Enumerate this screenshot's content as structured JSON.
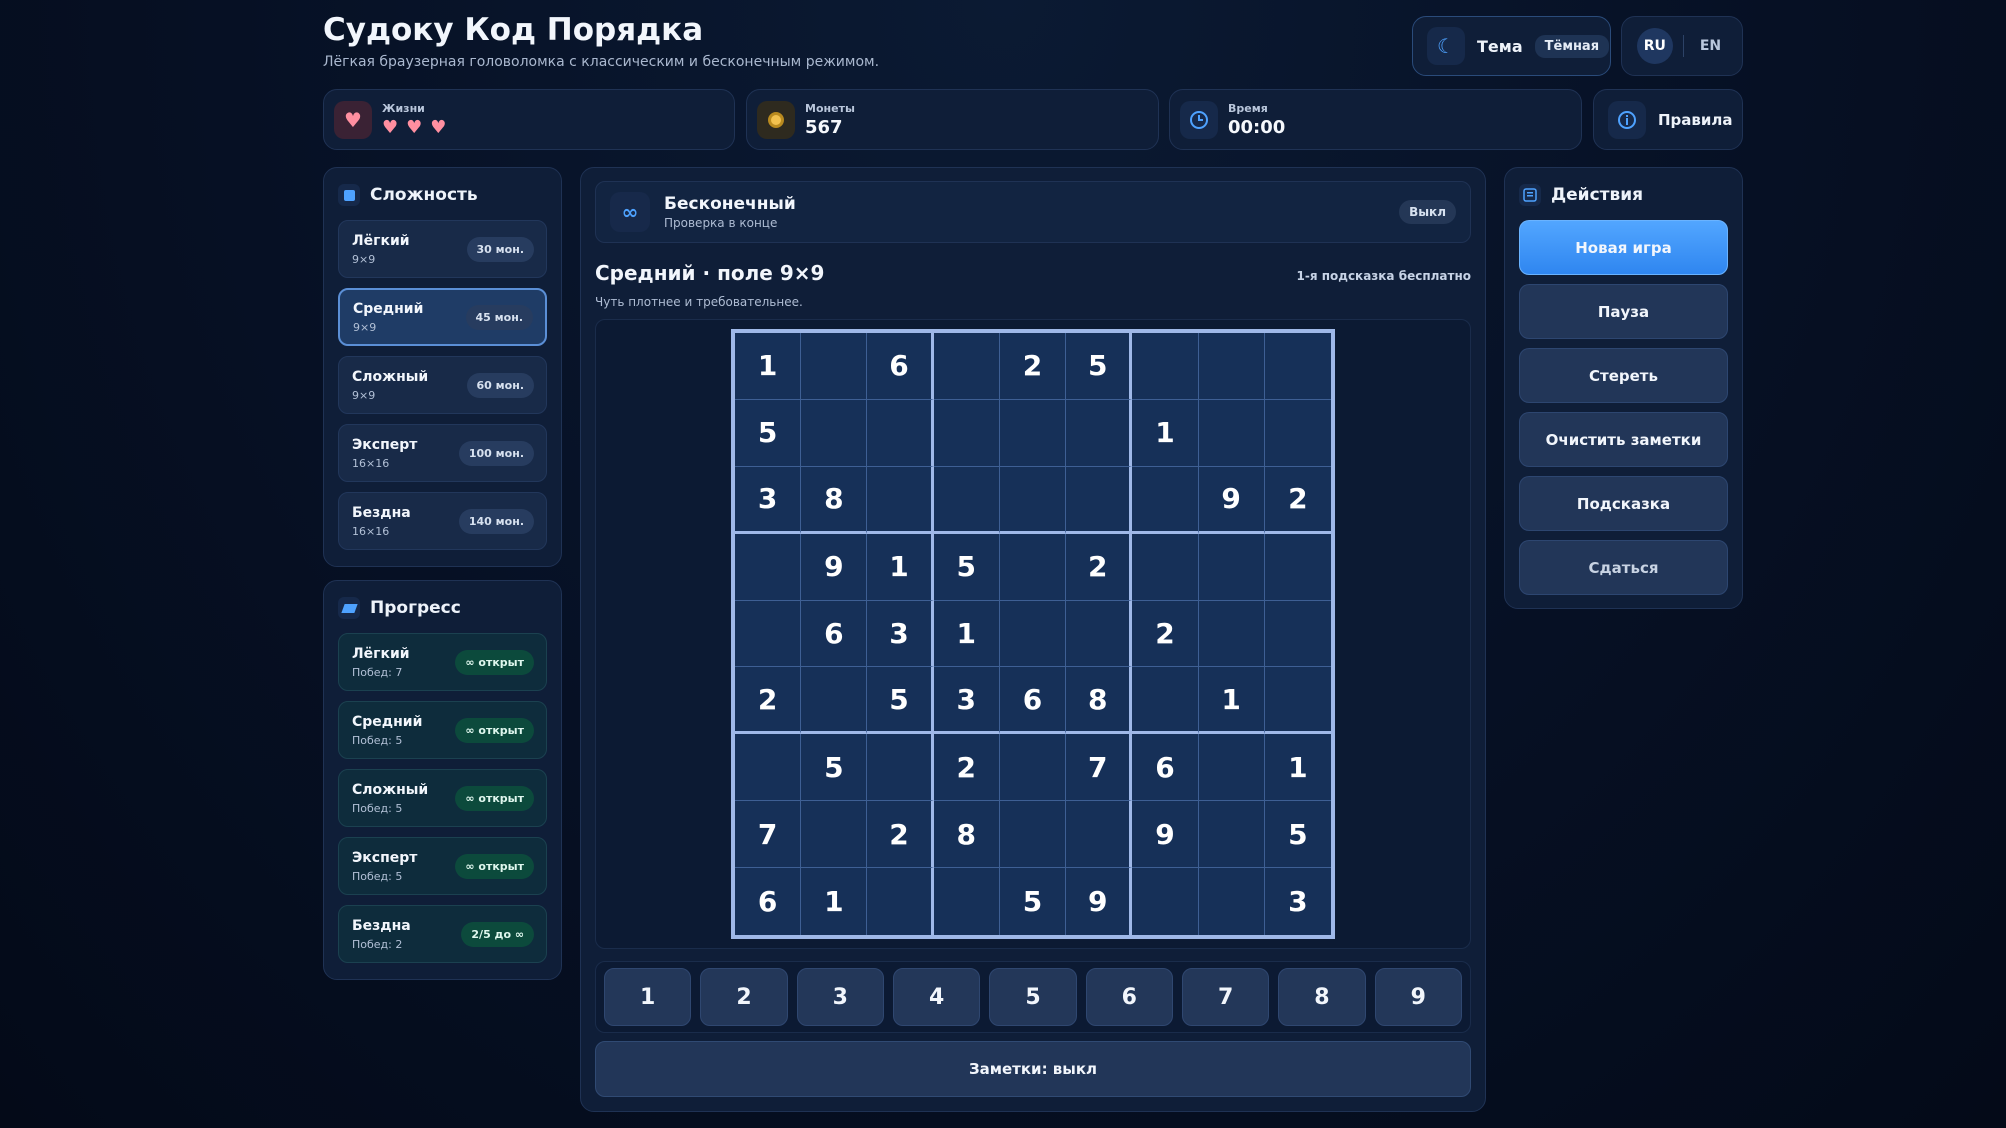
{
  "header": {
    "title": "Судоку Код Порядка",
    "subtitle": "Лёгкая браузерная головоломка с классическим и бесконечным режимом.",
    "theme_label": "Тема",
    "theme_value": "Тёмная",
    "lang_ru": "RU",
    "lang_en": "EN"
  },
  "stats": {
    "lives_label": "Жизни",
    "lives_count": 3,
    "coins_label": "Монеты",
    "coins_value": "567",
    "time_label": "Время",
    "time_value": "00:00",
    "rules_label": "Правила"
  },
  "difficulty": {
    "title": "Сложность",
    "items": [
      {
        "name": "Лёгкий",
        "size": "9×9",
        "cost": "30 мон."
      },
      {
        "name": "Средний",
        "size": "9×9",
        "cost": "45 мон."
      },
      {
        "name": "Сложный",
        "size": "9×9",
        "cost": "60 мон."
      },
      {
        "name": "Эксперт",
        "size": "16×16",
        "cost": "100 мон."
      },
      {
        "name": "Бездна",
        "size": "16×16",
        "cost": "140 мон."
      }
    ]
  },
  "progress": {
    "title": "Прогресс",
    "items": [
      {
        "name": "Лёгкий",
        "wins": "Побед: 7",
        "status": "∞ открыт"
      },
      {
        "name": "Средний",
        "wins": "Побед: 5",
        "status": "∞ открыт"
      },
      {
        "name": "Сложный",
        "wins": "Побед: 5",
        "status": "∞ открыт"
      },
      {
        "name": "Эксперт",
        "wins": "Побед: 5",
        "status": "∞ открыт"
      },
      {
        "name": "Бездна",
        "wins": "Побед: 2",
        "status": "2/5 до ∞"
      }
    ]
  },
  "mode": {
    "icon": "∞",
    "title": "Бесконечный",
    "subtitle": "Проверка в конце",
    "toggle": "Выкл"
  },
  "board": {
    "title": "Средний · поле 9×9",
    "hint_note": "1-я подсказка бесплатно",
    "subtitle": "Чуть плотнее и требовательнее.",
    "cells": [
      [
        "1",
        "",
        "6",
        "",
        "2",
        "5",
        "",
        "",
        ""
      ],
      [
        "5",
        "",
        "",
        "",
        "",
        "",
        "1",
        "",
        ""
      ],
      [
        "3",
        "8",
        "",
        "",
        "",
        "",
        "",
        "9",
        "2"
      ],
      [
        "",
        "9",
        "1",
        "5",
        "",
        "2",
        "",
        "",
        ""
      ],
      [
        "",
        "6",
        "3",
        "1",
        "",
        "",
        "2",
        "",
        ""
      ],
      [
        "2",
        "",
        "5",
        "3",
        "6",
        "8",
        "",
        "1",
        ""
      ],
      [
        "",
        "5",
        "",
        "2",
        "",
        "7",
        "6",
        "",
        "1"
      ],
      [
        "7",
        "",
        "2",
        "8",
        "",
        "",
        "9",
        "",
        "5"
      ],
      [
        "6",
        "1",
        "",
        "",
        "5",
        "9",
        "",
        "",
        "3"
      ]
    ]
  },
  "numpad": [
    "1",
    "2",
    "3",
    "4",
    "5",
    "6",
    "7",
    "8",
    "9"
  ],
  "notes_label": "Заметки: выкл",
  "actions": {
    "title": "Действия",
    "new_game": "Новая игра",
    "pause": "Пауза",
    "erase": "Стереть",
    "clear_notes": "Очистить заметки",
    "hint": "Подсказка",
    "give_up": "Сдаться"
  },
  "colors": {
    "accent": "#4ea2ff",
    "primary_button": "#3a90f5",
    "heart": "#ff8fa0",
    "coin": "#f2c14e",
    "board_border": "#9fb8e8"
  }
}
